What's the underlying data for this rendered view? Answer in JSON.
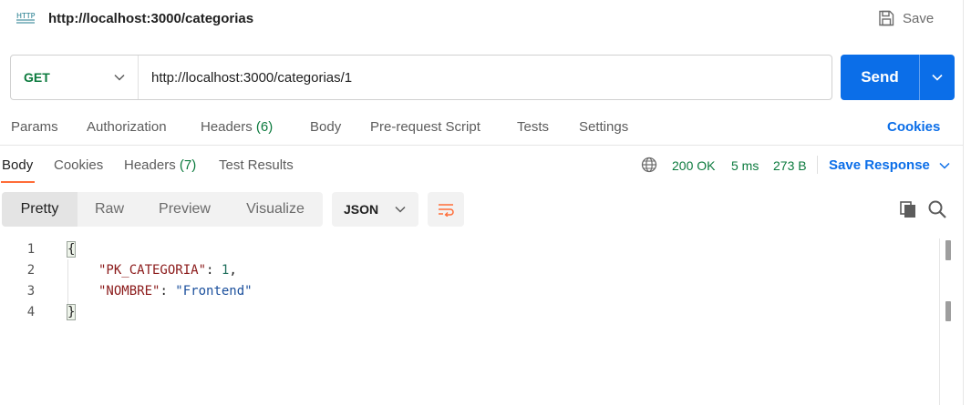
{
  "header": {
    "icon": "http-icon",
    "title": "http://localhost:3000/categorias",
    "save_label": "Save"
  },
  "request": {
    "method": "GET",
    "url": "http://localhost:3000/categorias/1",
    "send_label": "Send"
  },
  "request_tabs": {
    "params": "Params",
    "authorization": "Authorization",
    "headers_label": "Headers",
    "headers_count": "(6)",
    "body": "Body",
    "pre_request": "Pre-request Script",
    "tests": "Tests",
    "settings": "Settings",
    "cookies": "Cookies"
  },
  "response_tabs": {
    "body": "Body",
    "cookies": "Cookies",
    "headers_label": "Headers",
    "headers_count": "(7)",
    "test_results": "Test Results"
  },
  "response_meta": {
    "status": "200 OK",
    "time": "5 ms",
    "size": "273 B",
    "save_response": "Save Response"
  },
  "view": {
    "modes": [
      "Pretty",
      "Raw",
      "Preview",
      "Visualize"
    ],
    "active_mode": "Pretty",
    "format": "JSON"
  },
  "code": {
    "line_numbers": [
      "1",
      "2",
      "3",
      "4"
    ],
    "open_brace": "{",
    "key1": "\"PK_CATEGORIA\"",
    "val1": "1",
    "key2": "\"NOMBRE\"",
    "val2": "\"Frontend\"",
    "close_brace": "}"
  },
  "colors": {
    "accent": "#0b6ee8",
    "status_green": "#0b7a3d",
    "tab_underline": "#ff6c37"
  }
}
